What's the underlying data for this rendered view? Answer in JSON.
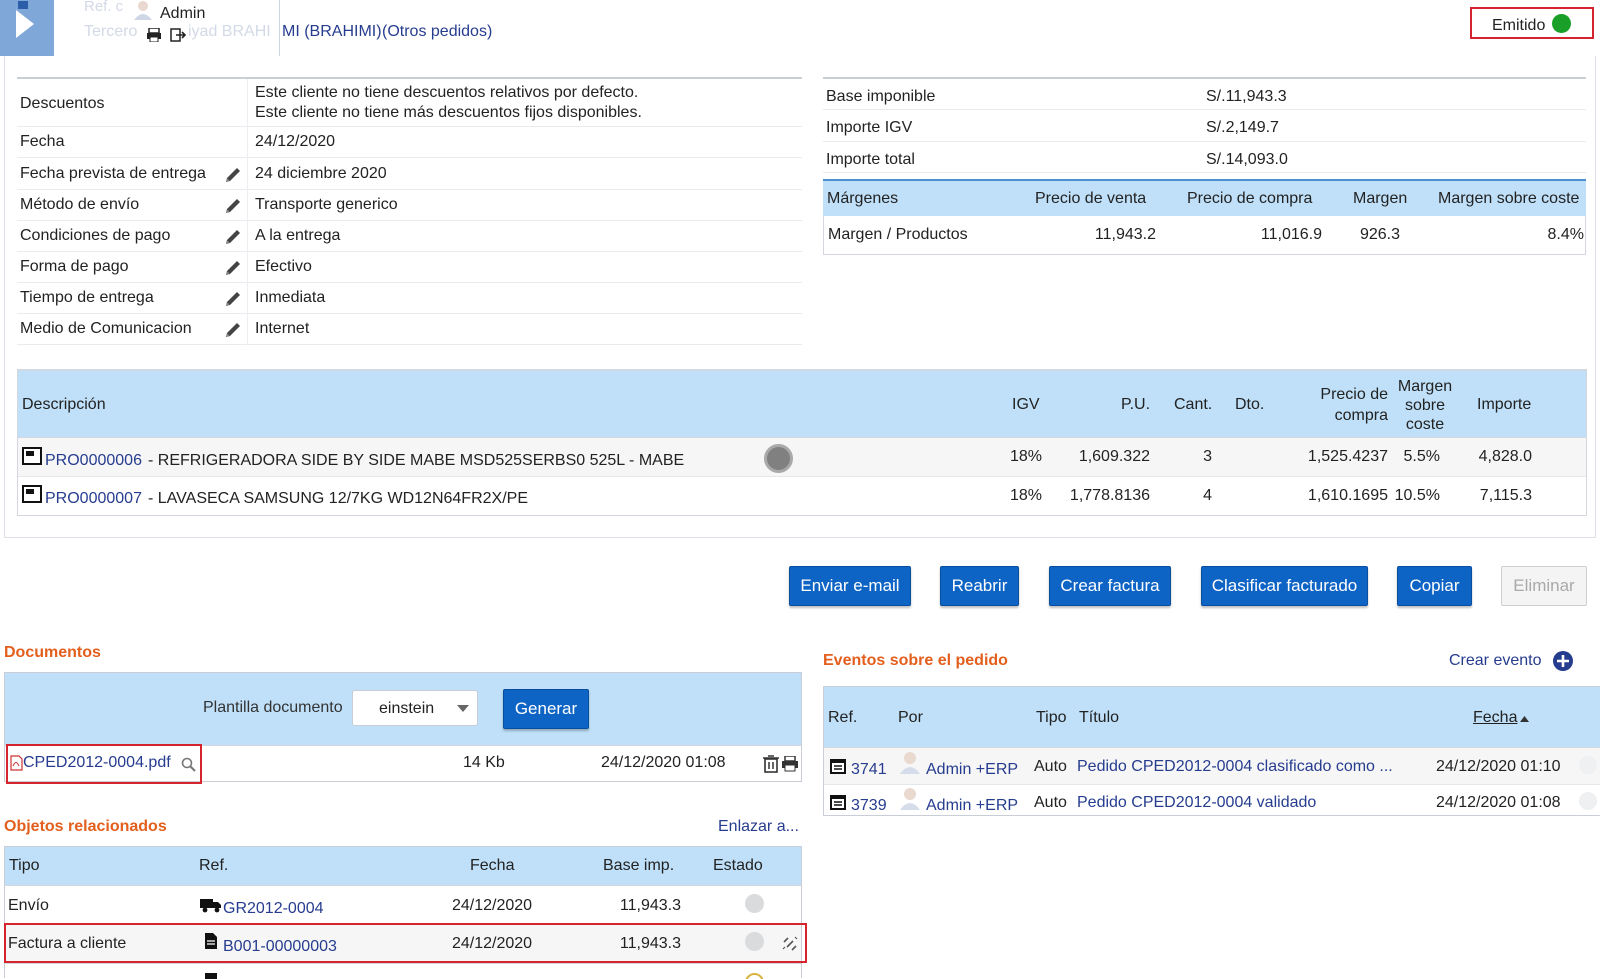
{
  "header": {
    "ref_ghost": "Ref. c",
    "user_name": "Admin",
    "third_party_ghost": "Tercero",
    "third_party_ghost2": "iyad BRAHI",
    "third_party_visible": "MI (BRAHIMI)",
    "other_orders_link": "(Otros pedidos)",
    "status_label": "Emitido",
    "status_color": "#1aa028"
  },
  "details": [
    {
      "label": "Descuentos",
      "value_line1": "Este cliente no tiene descuentos relativos por defecto.",
      "value_line2": "Este cliente no tiene más descuentos fijos disponibles.",
      "editable": false
    },
    {
      "label": "Fecha",
      "value": "24/12/2020",
      "editable": false
    },
    {
      "label": "Fecha prevista de entrega",
      "value": "24 diciembre 2020",
      "editable": true
    },
    {
      "label": "Método de envío",
      "value": "Transporte generico",
      "editable": true
    },
    {
      "label": "Condiciones de pago",
      "value": "A la entrega",
      "editable": true
    },
    {
      "label": "Forma de pago",
      "value": "Efectivo",
      "editable": true
    },
    {
      "label": "Tiempo de entrega",
      "value": "Inmediata",
      "editable": true
    },
    {
      "label": "Medio de Comunicacion",
      "value": "Internet",
      "editable": true
    }
  ],
  "amounts": [
    {
      "label": "Base imponible",
      "value": "S/.11,943.3"
    },
    {
      "label": "Importe IGV",
      "value": "S/.2,149.7"
    },
    {
      "label": "Importe total",
      "value": "S/.14,093.0"
    }
  ],
  "margins": {
    "headers": [
      "Márgenes",
      "Precio de venta",
      "Precio de compra",
      "Margen",
      "Margen sobre coste"
    ],
    "row": [
      "Margen / Productos",
      "11,943.2",
      "11,016.9",
      "926.3",
      "8.4%"
    ]
  },
  "lines": {
    "headers": {
      "desc": "Descripción",
      "igv": "IGV",
      "pu": "P.U.",
      "qty": "Cant.",
      "dto": "Dto.",
      "buy_1": "Precio de",
      "buy_2": "compra",
      "margin_1": "Margen",
      "margin_2": "sobre",
      "margin_3": "coste",
      "amount": "Importe"
    },
    "rows": [
      {
        "ref": "PRO0000006",
        "label": " - REFRIGERADORA SIDE BY SIDE MABE MSD525SERBS0 525L - MABE",
        "igv": "18%",
        "pu": "1,609.322",
        "qty": "3",
        "buy": "1,525.4237",
        "margin": "5.5%",
        "amount": "4,828.0"
      },
      {
        "ref": "PRO0000007",
        "label": " - LAVASECA SAMSUNG 12/7KG WD12N64FR2X/PE",
        "igv": "18%",
        "pu": "1,778.8136",
        "qty": "4",
        "buy": "1,610.1695",
        "margin": "10.5%",
        "amount": "7,115.3"
      }
    ]
  },
  "actions": {
    "send_email": "Enviar e-mail",
    "reopen": "Reabrir",
    "create_invoice": "Crear factura",
    "classify_billed": "Clasificar facturado",
    "copy": "Copiar",
    "delete": "Eliminar"
  },
  "documents": {
    "title": "Documentos",
    "template_label": "Plantilla documento",
    "template_value": "einstein",
    "generate": "Generar",
    "file_name": "CPED2012-0004.pdf",
    "file_size": "14 Kb",
    "file_date": "24/12/2020 01:08"
  },
  "related": {
    "title": "Objetos relacionados",
    "link_action": "Enlazar a...",
    "headers": [
      "Tipo",
      "Ref.",
      "Fecha",
      "Base imp.",
      "Estado"
    ],
    "rows": [
      {
        "type": "Envío",
        "ref": "GR2012-0004",
        "date": "24/12/2020",
        "base": "11,943.3"
      },
      {
        "type": "Factura a cliente",
        "ref": "B001-00000003",
        "date": "24/12/2020",
        "base": "11,943.3"
      }
    ]
  },
  "events": {
    "title": "Eventos sobre el pedido",
    "create": "Crear evento",
    "headers": {
      "ref": "Ref.",
      "by": "Por",
      "type": "Tipo",
      "title": "Título",
      "date": "Fecha"
    },
    "rows": [
      {
        "ref": "3741",
        "by": "Admin +ERP",
        "type": "Auto",
        "title": "Pedido CPED2012-0004 clasificado como ...",
        "date": "24/12/2020 01:10"
      },
      {
        "ref": "3739",
        "by": "Admin +ERP",
        "type": "Auto",
        "title": "Pedido CPED2012-0004 validado",
        "date": "24/12/2020 01:08"
      }
    ]
  }
}
